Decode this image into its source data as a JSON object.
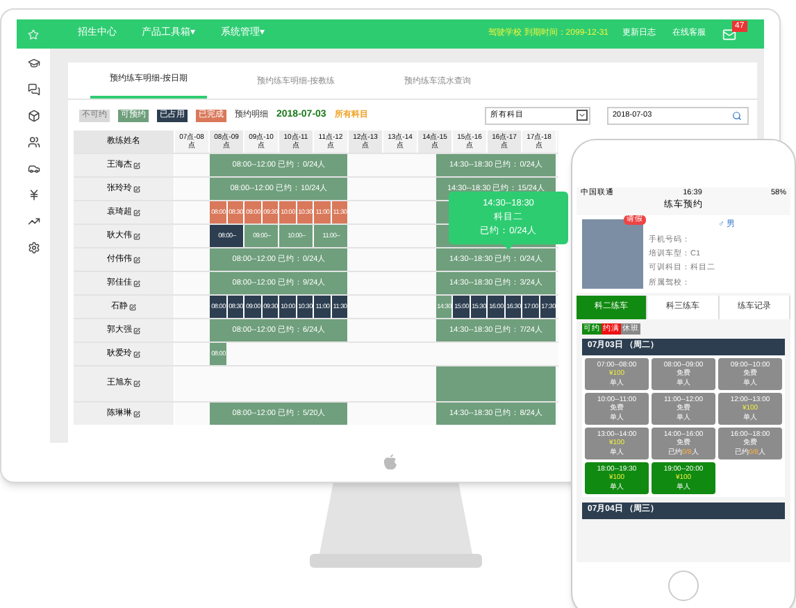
{
  "monitor": {
    "topbar": {
      "menu": [
        "招生中心",
        "产品工具箱▾",
        "系统管理▾"
      ],
      "expiry": "驾驶学校 到期时间：2099-12-31",
      "links": [
        "更新日志",
        "在线客服"
      ],
      "mail_badge": "47"
    },
    "tabs": [
      {
        "label": "预约练车明细-按日期",
        "selected": true
      },
      {
        "label": "预约练车明细-按教练",
        "selected": false
      },
      {
        "label": "预约练车流水查询",
        "selected": false
      }
    ],
    "legend": [
      {
        "label": "不可约",
        "color": "#d9d9d9"
      },
      {
        "label": "可预约",
        "color": "#6f9f7c"
      },
      {
        "label": "已占用",
        "color": "#2c3e50"
      },
      {
        "label": "已完成",
        "color": "#d9785a"
      }
    ],
    "detail_label": "预约明细",
    "date": "2018-07-03",
    "subject": "所有科目",
    "subject_select": {
      "value": "所有科目"
    },
    "date_field": {
      "value": "2018-07-03"
    },
    "table": {
      "columns": [
        "教练姓名",
        "07点-08点",
        "08点-09点",
        "09点-10点",
        "10点-11点",
        "11点-12点",
        "12点-13点",
        "13点-14点",
        "14点-15点",
        "15点-16点",
        "16点-17点",
        "17点-18点"
      ],
      "rows": [
        {
          "name": "王海杰",
          "morning": {
            "kind": "summary",
            "text": "08:00--12:00 已约：0/24人"
          },
          "afternoon": {
            "kind": "summary",
            "text": "14:30--18:30 已约：0/24人"
          }
        },
        {
          "name": "张玲玲",
          "morning": {
            "kind": "summary",
            "text": "08:00--12:00 已约：10/24人"
          },
          "afternoon": {
            "kind": "summary",
            "text": "14:30--18:30 已约：15/24人"
          }
        },
        {
          "name": "袁琦超",
          "morning": {
            "kind": "half_slots",
            "slots": [
              {
                "time": "08:00",
                "color": "#d9785a"
              },
              {
                "time": "08:30",
                "color": "#d9785a"
              },
              {
                "time": "09:00",
                "color": "#d9785a"
              },
              {
                "time": "09:30",
                "color": "#d9785a"
              },
              {
                "time": "10:00",
                "color": "#d9785a"
              },
              {
                "time": "10:30",
                "color": "#d9785a"
              },
              {
                "time": "11:00",
                "color": "#d9785a"
              },
              {
                "time": "11:30",
                "color": "#d9785a"
              }
            ]
          },
          "afternoon": {
            "kind": "blank"
          }
        },
        {
          "name": "耿大伟",
          "morning": {
            "kind": "hour_slots",
            "slots": [
              {
                "time": "08:00--",
                "color": "#2c3e50"
              },
              {
                "time": "09:00--",
                "color": "#6f9f7c"
              },
              {
                "time": "10:00--",
                "color": "#6f9f7c"
              },
              {
                "time": "11:00--",
                "color": "#6f9f7c"
              }
            ]
          },
          "afternoon": {
            "kind": "blank"
          }
        },
        {
          "name": "付伟伟",
          "morning": {
            "kind": "summary",
            "text": "08:00--12:00 已约：0/24人"
          },
          "afternoon": {
            "kind": "summary",
            "text": "14:30--18:30 已约：0/24人"
          }
        },
        {
          "name": "郭佳佳",
          "morning": {
            "kind": "summary",
            "text": "08:00--12:00 已约：9/24人"
          },
          "afternoon": {
            "kind": "summary",
            "text": "14:30--18:30 已约：3/24人"
          }
        },
        {
          "name": "石静",
          "morning": {
            "kind": "half_slots",
            "slots": [
              {
                "time": "08:00",
                "color": "#2c3e50"
              },
              {
                "time": "08:30",
                "color": "#2c3e50"
              },
              {
                "time": "09:00",
                "color": "#2c3e50"
              },
              {
                "time": "09:30",
                "color": "#2c3e50"
              },
              {
                "time": "10:00",
                "color": "#2c3e50"
              },
              {
                "time": "10:30",
                "color": "#2c3e50"
              },
              {
                "time": "11:00",
                "color": "#2c3e50"
              },
              {
                "time": "11:30",
                "color": "#2c3e50"
              }
            ]
          },
          "afternoon": {
            "kind": "half_slots",
            "slots": [
              {
                "time": "14:30",
                "color": "#6f9f7c"
              },
              {
                "time": "15:00",
                "color": "#2c3e50"
              },
              {
                "time": "15:30",
                "color": "#2c3e50"
              },
              {
                "time": "16:00",
                "color": "#2c3e50"
              },
              {
                "time": "16:30",
                "color": "#2c3e50"
              },
              {
                "time": "17:00",
                "color": "#2c3e50"
              },
              {
                "time": "17:30",
                "color": "#2c3e50"
              }
            ]
          }
        },
        {
          "name": "郭大强",
          "morning": {
            "kind": "summary",
            "text": "08:00--12:00 已约：6/24人"
          },
          "afternoon": {
            "kind": "summary",
            "text": "14:30--18:30 已约：7/24人"
          }
        },
        {
          "name": "耿爱玲",
          "morning": {
            "kind": "half_slots",
            "slots": [
              {
                "time": "08:00",
                "color": "#6f9f7c"
              }
            ]
          }
        },
        {
          "name": "王旭东",
          "afternoon": {
            "kind": "blank"
          }
        },
        {
          "name": "陈琳琳",
          "morning": {
            "kind": "summary",
            "text": "08:00--12:00 已约：5/20人"
          },
          "afternoon": {
            "kind": "summary",
            "text": "14:30--18:30 已约：8/24人"
          }
        }
      ]
    },
    "tooltip": {
      "lines": [
        "14:30--18:30",
        "科目二",
        "已约：0/24人"
      ]
    }
  },
  "phone": {
    "status": {
      "carrier": "中国联通",
      "time": "16:39",
      "battery": "58%"
    },
    "title": "练车预约",
    "profile": {
      "badge": "请假",
      "gender": "♂ 男",
      "fields": [
        "手机号码：",
        "培训车型：C1",
        "可训科目：科目二",
        "所属驾校："
      ]
    },
    "tabs": [
      {
        "label": "科二练车",
        "selected": true
      },
      {
        "label": "科三练车",
        "selected": false
      },
      {
        "label": "练车记录",
        "selected": false
      }
    ],
    "legend": [
      {
        "label": "可约",
        "color": "#118a11"
      },
      {
        "label": "约满",
        "color": "#ee1111"
      },
      {
        "label": "休班",
        "color": "#888888"
      }
    ],
    "days": [
      {
        "label": "07月03日 （周二）",
        "slots": [
          {
            "time": "07:00--08:00",
            "price": "¥100",
            "price_highlighted": true,
            "note": "单人",
            "open": false
          },
          {
            "time": "08:00--09:00",
            "price": "免费",
            "price_highlighted": false,
            "note": "单人",
            "open": false
          },
          {
            "time": "09:00--10:00",
            "price": "免费",
            "price_highlighted": false,
            "note": "单人",
            "open": false
          },
          {
            "time": "10:00--11:00",
            "price": "免费",
            "price_highlighted": false,
            "note": "单人",
            "open": false
          },
          {
            "time": "11:00--12:00",
            "price": "免费",
            "price_highlighted": false,
            "note": "单人",
            "open": false
          },
          {
            "time": "12:00--13:00",
            "price": "¥100",
            "price_highlighted": true,
            "note": "单人",
            "open": false
          },
          {
            "time": "13:00--14:00",
            "price": "¥100",
            "price_highlighted": true,
            "note": "单人",
            "open": false
          },
          {
            "time": "14:00--16:00",
            "price": "免费",
            "price_highlighted": false,
            "note_pre": "已约",
            "count": "0/8",
            "note_post": "人",
            "open": false
          },
          {
            "time": "16:00--18:00",
            "price": "免费",
            "price_highlighted": false,
            "note_pre": "已约",
            "count": "0/8",
            "note_post": "人",
            "open": false
          },
          {
            "time": "18:00--19:30",
            "price": "¥100",
            "price_highlighted": true,
            "note": "单人",
            "open": true
          },
          {
            "time": "19:00--20:00",
            "price": "¥100",
            "price_highlighted": true,
            "note": "单人",
            "open": true
          }
        ]
      },
      {
        "label": "07月04日 （周三）"
      }
    ]
  }
}
